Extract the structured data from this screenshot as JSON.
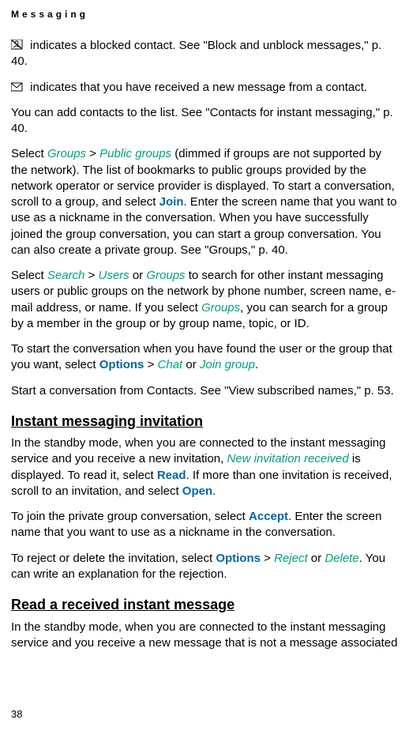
{
  "header": "Messaging",
  "p1": {
    "t1": " indicates a blocked contact. See \"Block and unblock messages,\" p. 40."
  },
  "p2": {
    "t1": " indicates that you have received a new message from a contact."
  },
  "p3": "You can add contacts to the list. See \"Contacts for instant messaging,\" p. 40.",
  "p4": {
    "a": "Select ",
    "groups": "Groups",
    "gt1": " > ",
    "public": "Public groups",
    "b": " (dimmed if groups are not supported by the network). The list of bookmarks to public groups provided by the network operator or service provider is displayed. To start a conversation, scroll to a group, and select ",
    "join": "Join",
    "c": ". Enter the screen name that you want to use as a nickname in the conversation. When you have successfully joined the group conversation, you can start a group conversation. You can also create a private group. See \"Groups,\" p. 40."
  },
  "p5": {
    "a": "Select ",
    "search": "Search",
    "gt1": " > ",
    "users": "Users",
    "or1": " or ",
    "groups": "Groups",
    "b": " to search for other instant messaging users or public groups on the network by phone number, screen name, e-mail address, or name. If you select ",
    "groups2": "Groups",
    "c": ", you can search for a group by a member in the group or by group name, topic, or ID."
  },
  "p6": {
    "a": "To start the conversation when you have found the user or the group that you want, select ",
    "options": "Options",
    "gt1": " > ",
    "chat": "Chat",
    "or1": " or ",
    "joingroup": "Join group",
    "dot": "."
  },
  "p7": "Start a conversation from Contacts. See \"View subscribed names,\" p. 53.",
  "h1": "Instant messaging invitation",
  "p8": {
    "a": "In the standby mode, when you are connected to the instant messaging service and you receive a new invitation, ",
    "newinv": "New invitation received",
    "b": " is displayed. To read it, select ",
    "read": "Read",
    "c": ". If more than one invitation is received, scroll to an invitation, and select ",
    "open": "Open",
    "dot": "."
  },
  "p9": {
    "a": "To join the private group conversation, select ",
    "accept": "Accept",
    "b": ". Enter the screen name that you want to use as a nickname in the conversation."
  },
  "p10": {
    "a": "To reject or delete the invitation, select ",
    "options": "Options",
    "gt1": " > ",
    "reject": "Reject",
    "or1": " or ",
    "delete": "Delete",
    "b": ". You can write an explanation for the rejection."
  },
  "h2": "Read a received instant message",
  "p11": "In the standby mode, when you are connected to the instant messaging service and you receive a new message that is not a message associated",
  "pagenum": "38"
}
